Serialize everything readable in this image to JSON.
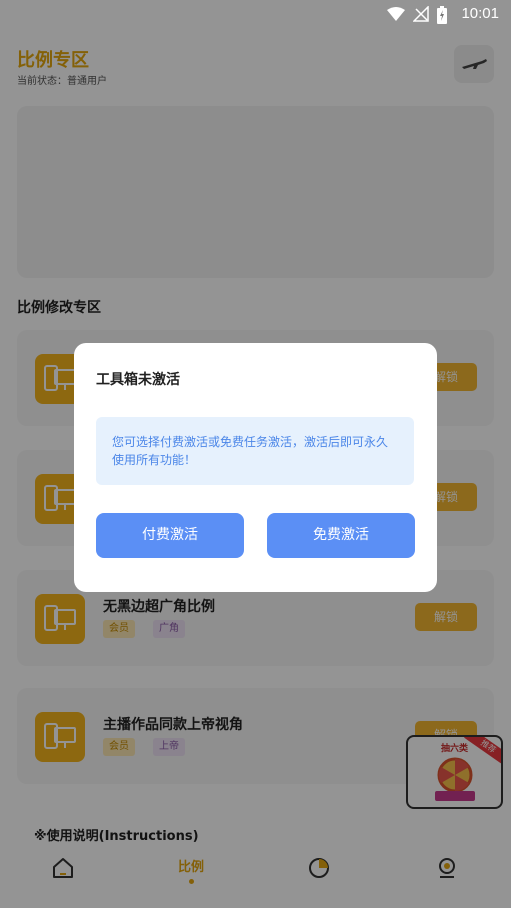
{
  "status_bar": {
    "time": "10:01"
  },
  "header": {
    "title": "比例专区",
    "status_text": "当前状态：普通用户"
  },
  "section_title": "比例修改专区",
  "cards": [
    {
      "title": "",
      "vip": "",
      "tag": "",
      "unlock": "解锁"
    },
    {
      "title": "",
      "vip": "",
      "tag": "",
      "unlock": "解锁"
    },
    {
      "title": "无黑边超广角比例",
      "vip": "会员",
      "tag": "广角",
      "unlock": "解锁"
    },
    {
      "title": "主播作品同款上帝视角",
      "vip": "会员",
      "tag": "上帝",
      "unlock": "解锁"
    }
  ],
  "instructions_title": "※使用说明(Instructions)",
  "promo": {
    "label": "抽六类",
    "ribbon": "推荐"
  },
  "bottom_nav": {
    "active_label": "比例"
  },
  "dialog": {
    "title": "工具箱未激活",
    "message": "您可选择付费激活或免费任务激活，激活后即可永久使用所有功能！",
    "paid_button": "付费激活",
    "free_button": "免费激活"
  },
  "colors": {
    "accent": "#e4a70f",
    "primary_button": "#5b8ff5",
    "note_bg": "#e6f1fd",
    "note_text": "#4b86e8"
  }
}
